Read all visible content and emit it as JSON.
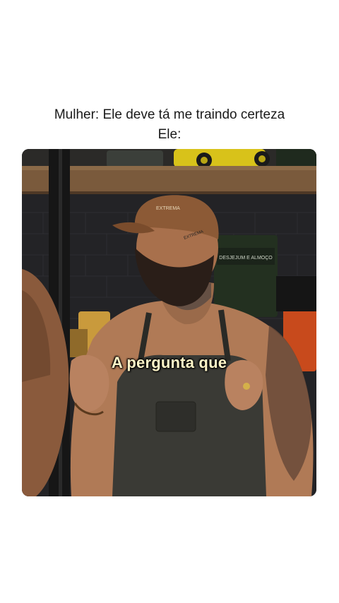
{
  "caption": {
    "line1": "Mulher: Ele deve tá me traindo certeza",
    "line2": "Ele:"
  },
  "media": {
    "subtitle": "A pergunta que",
    "shelf_sign_text": "DESJEJUM E ALMOÇO",
    "cap_logo_text": "EXTREMA"
  }
}
